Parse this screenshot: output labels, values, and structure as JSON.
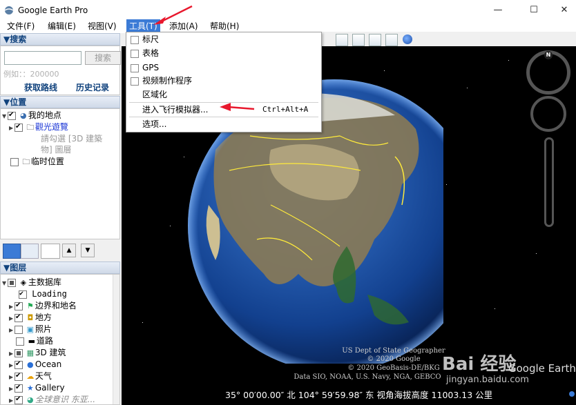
{
  "window": {
    "title": "Google Earth Pro",
    "minimize": "—",
    "maximize": "☐",
    "close": "✕"
  },
  "menubar": [
    "文件(F)",
    "编辑(E)",
    "视图(V)",
    "工具(T)",
    "添加(A)",
    "帮助(H)"
  ],
  "search_panel": {
    "header": "▼搜索",
    "search_button": "搜索",
    "placeholder": "例如：：200000",
    "directions_link": "获取路线",
    "history_link": "历史记录"
  },
  "places_panel": {
    "header": "▼位置",
    "items": [
      {
        "label": "我的地点",
        "icon": "globe-icon"
      },
      {
        "label": "觀光遊覽",
        "icon": "folder-icon"
      },
      {
        "label": "請勾選 [3D 建築",
        "sub": true
      },
      {
        "label": "物] 圖層",
        "sub": true
      },
      {
        "label": "临时位置",
        "icon": "folder-icon"
      }
    ]
  },
  "layers_panel": {
    "header": "▼图层",
    "items": [
      {
        "label": "主数据库",
        "icon": "layers-icon",
        "state": "part"
      },
      {
        "label": "Loading",
        "state": "on"
      },
      {
        "label": "边界和地名",
        "icon": "flag-icon",
        "state": "on"
      },
      {
        "label": "地方",
        "icon": "place-icon",
        "state": "on"
      },
      {
        "label": "照片",
        "icon": "photo-icon",
        "state": "off"
      },
      {
        "label": "道路",
        "icon": "road-icon",
        "state": "off"
      },
      {
        "label": "3D 建筑",
        "icon": "building-icon",
        "state": "part"
      },
      {
        "label": "Ocean",
        "icon": "ocean-icon",
        "state": "on"
      },
      {
        "label": "天气",
        "icon": "weather-icon",
        "state": "on"
      },
      {
        "label": "Gallery",
        "icon": "gallery-icon",
        "state": "on"
      },
      {
        "label": "全球意识",
        "icon": "globe-icon",
        "state": "on",
        "suffix": "东亚..."
      }
    ]
  },
  "tools_menu": {
    "items": [
      {
        "label": "标尺",
        "checkbox": true
      },
      {
        "label": "表格",
        "checkbox": true
      },
      {
        "label": "GPS",
        "checkbox": true
      },
      {
        "label": "视频制作程序",
        "checkbox": true
      },
      {
        "label": "区域化",
        "checkbox": false
      },
      {
        "label": "进入飞行模拟器...",
        "checkbox": false,
        "shortcut": "Ctrl+Alt+A"
      },
      {
        "label": "选项...",
        "checkbox": false
      }
    ]
  },
  "credits": {
    "line1": "US Dept of State Geographer",
    "line2": "© 2020 Google",
    "line3": "© 2020 GeoBasis-DE/BKG",
    "line4": "Data SIO, NOAA, U.S. Navy, NGA, GEBCO"
  },
  "logo": "Google Earth",
  "status": {
    "lat": "35° 00′00.00″ 北",
    "lon": "104° 59′59.98″ 东",
    "alt_label": "视角海拔高度",
    "alt_value": "11003.13 公里"
  },
  "watermark": {
    "brand": "Bai 经验",
    "url": "jingyan.baidu.com"
  },
  "nav": {
    "north": "N"
  },
  "colors": {
    "accent": "#3b7bd6",
    "annotation": "#e8182d"
  }
}
